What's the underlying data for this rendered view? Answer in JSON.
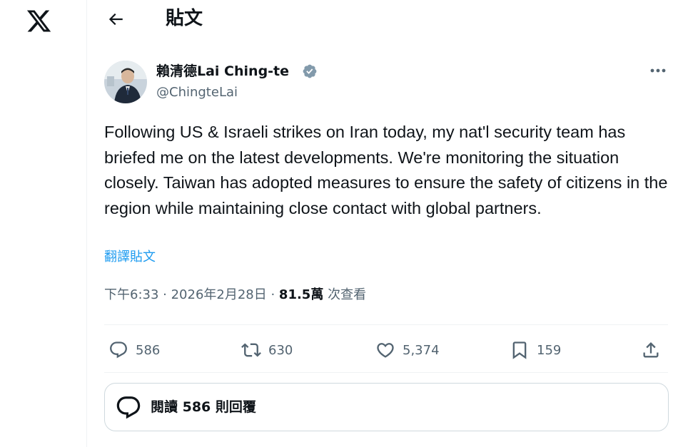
{
  "header": {
    "title": "貼文"
  },
  "tweet": {
    "display_name": "賴清德Lai Ching-te",
    "handle": "@ChingteLai",
    "text": "Following US & Israeli strikes on Iran today, my nat'l security team has briefed me on the latest developments. We're monitoring the situation closely. Taiwan has adopted measures to ensure the safety of citizens in the region while maintaining close contact with global partners.",
    "translate_label": "翻譯貼文",
    "timestamp": "下午6:33 · 2026年2月28日 · ",
    "views_count": "81.5萬",
    "views_label": " 次查看"
  },
  "actions": {
    "replies": "586",
    "reposts": "630",
    "likes": "5,374",
    "bookmarks": "159"
  },
  "replies_box": {
    "label": "閱讀 586 則回覆"
  },
  "icons": {
    "logo": "x-logo-icon",
    "back": "back-arrow-icon",
    "verified": "verified-badge-icon",
    "more": "more-horizontal-icon",
    "reply": "reply-icon",
    "repost": "repost-icon",
    "like": "heart-icon",
    "bookmark": "bookmark-icon",
    "share": "share-icon",
    "replies": "speech-bubble-icon"
  },
  "colors": {
    "accent": "#1d9bf0",
    "secondary_text": "#536471",
    "primary_text": "#0f1419",
    "verified_badge": "#829aab"
  }
}
